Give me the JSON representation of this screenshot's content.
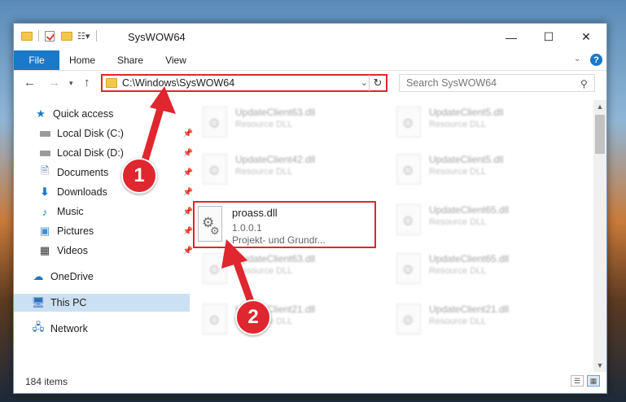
{
  "window": {
    "title": "SysWOW64",
    "controls": {
      "minimize": "—",
      "maximize": "☐",
      "close": "✕"
    }
  },
  "ribbon": {
    "tabs": [
      {
        "label": "File"
      },
      {
        "label": "Home"
      },
      {
        "label": "Share"
      },
      {
        "label": "View"
      }
    ]
  },
  "address": {
    "path": "C:\\Windows\\SysWOW64",
    "search_placeholder": "Search SysWOW64"
  },
  "nav": {
    "items": [
      {
        "label": "Quick access",
        "icon": "star-icon"
      },
      {
        "label": "Local Disk (C:)",
        "icon": "drive-icon"
      },
      {
        "label": "Local Disk (D:)",
        "icon": "drive-icon"
      },
      {
        "label": "Documents",
        "icon": "documents-icon"
      },
      {
        "label": "Downloads",
        "icon": "download-icon"
      },
      {
        "label": "Music",
        "icon": "music-icon"
      },
      {
        "label": "Pictures",
        "icon": "pictures-icon"
      },
      {
        "label": "Videos",
        "icon": "videos-icon"
      },
      {
        "label": "OneDrive",
        "icon": "cloud-icon"
      },
      {
        "label": "This PC",
        "icon": "computer-icon"
      },
      {
        "label": "Network",
        "icon": "network-icon"
      }
    ]
  },
  "files": [
    {
      "name": "UpdateClient63.dll",
      "desc": "Resource DLL"
    },
    {
      "name": "UpdateClient5.dll",
      "desc": "Resource DLL"
    },
    {
      "name": "UpdateClient42.dll",
      "desc": "Resource DLL"
    },
    {
      "name": "UpdateClient5.dll",
      "desc": "Resource DLL"
    },
    {
      "name": "UpdateClient65.dll",
      "desc": "Resource DLL"
    },
    {
      "name": "UpdateClient63.dll",
      "desc": "Resource DLL"
    },
    {
      "name": "UpdateClient65.dll",
      "desc": "Resource DLL"
    },
    {
      "name": "UpdateClient21.dll",
      "desc": "Resource DLL"
    },
    {
      "name": "UpdateClient21.dll",
      "desc": "Resource DLL"
    }
  ],
  "highlighted_file": {
    "name": "proass.dll",
    "version": "1.0.0.1",
    "desc": "Projekt- und Grundr..."
  },
  "status": {
    "item_count": "184 items"
  },
  "callouts": {
    "step1": "1",
    "step2": "2",
    "color": "#e0262e"
  }
}
